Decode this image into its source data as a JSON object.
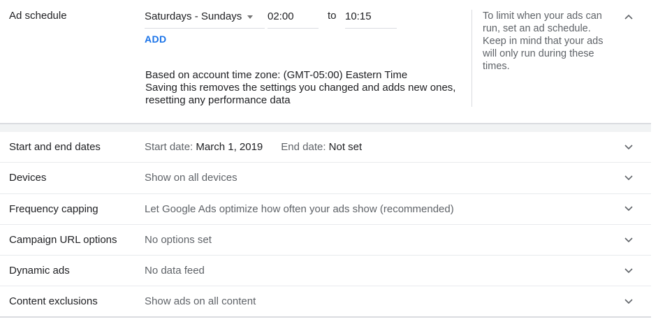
{
  "ad_schedule": {
    "title": "Ad schedule",
    "day_range": "Saturdays - Sundays",
    "start_time": "02:00",
    "to_label": "to",
    "end_time": "10:15",
    "add_label": "ADD",
    "timezone_note": "Based on account time zone: (GMT-05:00) Eastern Time",
    "warning_note": "Saving this removes the settings you changed and adds new ones, resetting any performance data",
    "help_text": "To limit when your ads can run, set an ad schedule. Keep in mind that your ads will only run during these times.",
    "collapse_icon": "chevron-up-icon"
  },
  "settings_rows": [
    {
      "label": "Start and end dates",
      "start_date_label": "Start date:",
      "start_date_value": "March 1, 2019",
      "end_date_label": "End date:",
      "end_date_value": "Not set",
      "icon": "chevron-down-icon"
    },
    {
      "label": "Devices",
      "value": "Show on all devices",
      "icon": "chevron-down-icon"
    },
    {
      "label": "Frequency capping",
      "value": "Let Google Ads optimize how often your ads show (recommended)",
      "icon": "chevron-down-icon"
    },
    {
      "label": "Campaign URL options",
      "value": "No options set",
      "icon": "chevron-down-icon"
    },
    {
      "label": "Dynamic ads",
      "value": "No data feed",
      "icon": "chevron-down-icon"
    },
    {
      "label": "Content exclusions",
      "value": "Show ads on all content",
      "icon": "chevron-down-icon"
    }
  ],
  "colors": {
    "accent": "#1a73e8",
    "text_primary": "#202124",
    "text_secondary": "#5f6368",
    "divider": "#dadce0"
  }
}
